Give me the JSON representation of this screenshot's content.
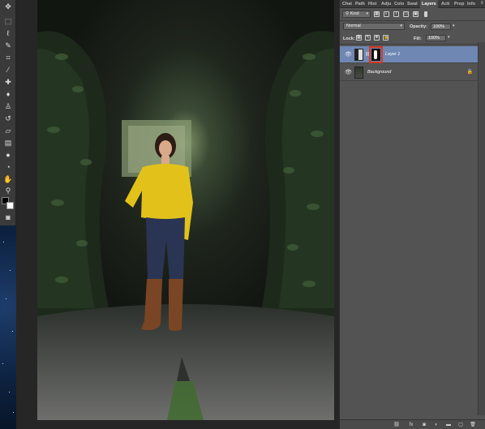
{
  "panel": {
    "tabs": [
      "Chai",
      "Path",
      "Hist",
      "Adju",
      "Colo",
      "Swat",
      "Layers",
      "Acti",
      "Prop",
      "Info"
    ],
    "active_tab": "Layers",
    "filter": {
      "kind_label": "Kind"
    },
    "blend_mode": "Normal",
    "opacity": {
      "label": "Opacity:",
      "value": "100%"
    },
    "lock": {
      "label": "Lock:"
    },
    "fill": {
      "label": "Fill:",
      "value": "100%"
    },
    "layers": [
      {
        "name": "Layer 1",
        "selected": true,
        "has_mask": true,
        "mask_highlight_color": "#d2391f"
      },
      {
        "name": "Background",
        "selected": false,
        "locked": true
      }
    ]
  },
  "colors": {
    "selection": "#6f87b3",
    "panel_bg": "#535353",
    "highlight_box": "#d2391f"
  },
  "toolbar": {
    "tools": [
      "move-tool",
      "marquee-tool",
      "lasso-tool",
      "quick-select-tool",
      "crop-tool",
      "eyedropper-tool",
      "healing-brush-tool",
      "brush-tool",
      "clone-stamp-tool",
      "history-brush-tool",
      "eraser-tool",
      "gradient-tool",
      "blur-tool",
      "dodge-tool",
      "pen-tool",
      "type-tool",
      "path-select-tool",
      "shape-tool",
      "hand-tool",
      "zoom-tool"
    ]
  }
}
